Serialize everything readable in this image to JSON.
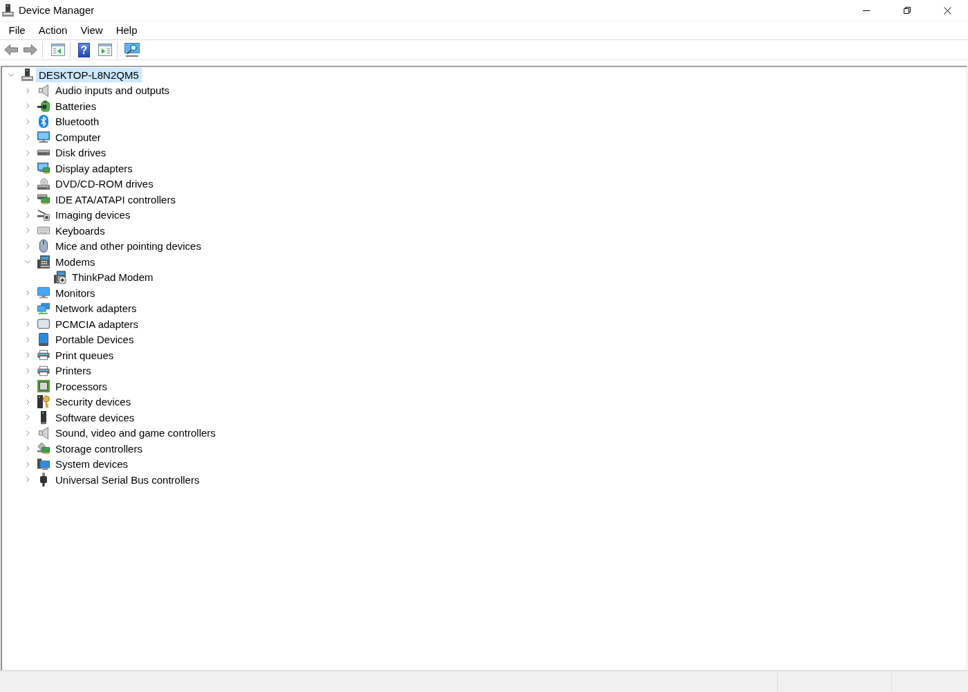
{
  "window": {
    "title": "Device Manager"
  },
  "menu": [
    {
      "label": "File"
    },
    {
      "label": "Action"
    },
    {
      "label": "View"
    },
    {
      "label": "Help"
    }
  ],
  "toolbar": {
    "groups": [
      {
        "buttons": [
          {
            "kind": "back"
          },
          {
            "kind": "forward"
          }
        ]
      },
      {
        "buttons": [
          {
            "kind": "properties"
          }
        ]
      },
      {
        "buttons": [
          {
            "kind": "help",
            "glyph": "?"
          },
          {
            "kind": "showhide"
          }
        ]
      },
      {
        "buttons": [
          {
            "kind": "scan"
          }
        ]
      }
    ]
  },
  "tree": {
    "label": "DESKTOP-L8N2QM5",
    "kind": "host",
    "expanded": true,
    "selected": true,
    "children": [
      {
        "label": "Audio inputs and outputs",
        "kind": "audio",
        "expanded": false,
        "selected": false
      },
      {
        "label": "Batteries",
        "kind": "battery",
        "expanded": false,
        "selected": false
      },
      {
        "label": "Bluetooth",
        "kind": "bluetooth",
        "expanded": false,
        "selected": false
      },
      {
        "label": "Computer",
        "kind": "computer",
        "expanded": false,
        "selected": false
      },
      {
        "label": "Disk drives",
        "kind": "disk",
        "expanded": false,
        "selected": false
      },
      {
        "label": "Display adapters",
        "kind": "display",
        "expanded": false,
        "selected": false
      },
      {
        "label": "DVD/CD-ROM drives",
        "kind": "dvd",
        "expanded": false,
        "selected": false
      },
      {
        "label": "IDE ATA/ATAPI controllers",
        "kind": "ide",
        "expanded": false,
        "selected": false
      },
      {
        "label": "Imaging devices",
        "kind": "imaging",
        "expanded": false,
        "selected": false
      },
      {
        "label": "Keyboards",
        "kind": "keyboard",
        "expanded": false,
        "selected": false
      },
      {
        "label": "Mice and other pointing devices",
        "kind": "mouse",
        "expanded": false,
        "selected": false
      },
      {
        "label": "Modems",
        "kind": "modem",
        "expanded": true,
        "selected": false,
        "children": [
          {
            "label": "ThinkPad Modem",
            "kind": "fax",
            "selected": false
          }
        ]
      },
      {
        "label": "Monitors",
        "kind": "monitor",
        "expanded": false,
        "selected": false
      },
      {
        "label": "Network adapters",
        "kind": "network",
        "expanded": false,
        "selected": false
      },
      {
        "label": "PCMCIA adapters",
        "kind": "pcmcia",
        "expanded": false,
        "selected": false
      },
      {
        "label": "Portable Devices",
        "kind": "portable",
        "expanded": false,
        "selected": false
      },
      {
        "label": "Print queues",
        "kind": "printqueue",
        "expanded": false,
        "selected": false
      },
      {
        "label": "Printers",
        "kind": "printer",
        "expanded": false,
        "selected": false
      },
      {
        "label": "Processors",
        "kind": "processor",
        "expanded": false,
        "selected": false
      },
      {
        "label": "Security devices",
        "kind": "security",
        "expanded": false,
        "selected": false
      },
      {
        "label": "Software devices",
        "kind": "software",
        "expanded": false,
        "selected": false
      },
      {
        "label": "Sound, video and game controllers",
        "kind": "sound",
        "expanded": false,
        "selected": false
      },
      {
        "label": "Storage controllers",
        "kind": "storage",
        "expanded": false,
        "selected": false
      },
      {
        "label": "System devices",
        "kind": "system",
        "expanded": false,
        "selected": false
      },
      {
        "label": "Universal Serial Bus controllers",
        "kind": "usb",
        "expanded": false,
        "selected": false
      }
    ]
  }
}
